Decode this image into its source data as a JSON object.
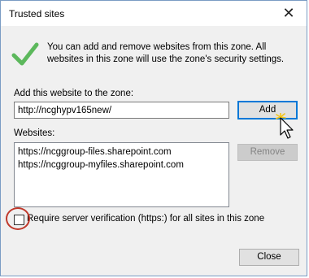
{
  "window": {
    "title": "Trusted sites",
    "close_glyph": "✕"
  },
  "info": {
    "icon": "green-check-icon",
    "text": "You can add and remove websites from this zone. All websites in this zone will use the zone's security settings."
  },
  "add_section": {
    "label": "Add this website to the zone:",
    "url_value": "http://ncghypv165new/",
    "add_button": "Add"
  },
  "websites_section": {
    "label": "Websites:",
    "items": [
      "https://ncggroup-files.sharepoint.com",
      "https://ncggroup-myfiles.sharepoint.com"
    ],
    "remove_button": "Remove"
  },
  "require_verification": {
    "label": "Require server verification (https:) for all sites in this zone",
    "checked": false
  },
  "footer": {
    "close_button": "Close"
  },
  "colors": {
    "accent": "#0078d7",
    "check_green": "#4caf50",
    "highlight_ring": "#c0392b"
  }
}
